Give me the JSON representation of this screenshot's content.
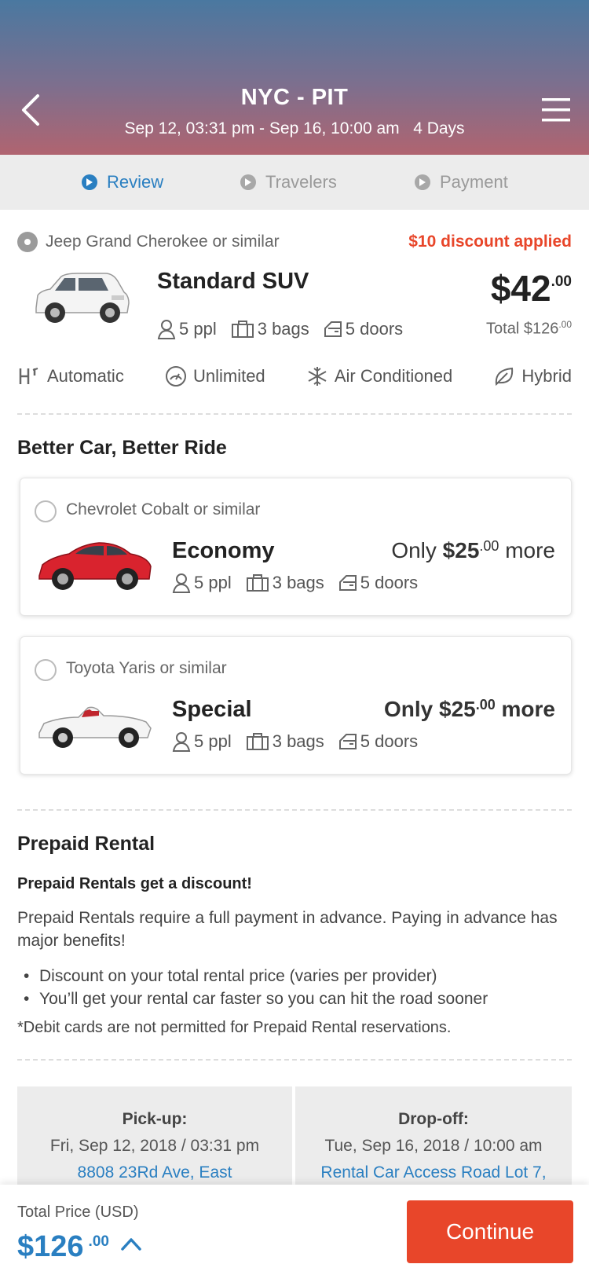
{
  "header": {
    "route": "NYC - PIT",
    "dates": "Sep 12, 03:31 pm - Sep 16, 10:00 am",
    "duration": "4 Days"
  },
  "steps": [
    {
      "label": "Review",
      "active": true
    },
    {
      "label": "Travelers",
      "active": false
    },
    {
      "label": "Payment",
      "active": false
    }
  ],
  "selected_car": {
    "similar": "Jeep Grand Cherokee or similar",
    "discount": "$10 discount applied",
    "name": "Standard SUV",
    "ppl": "5 ppl",
    "bags": "3 bags",
    "doors": "5 doors",
    "price_main": "$42",
    "price_cents": ".00",
    "total_main": "Total $126",
    "total_cents": ".00"
  },
  "features": [
    "Automatic",
    "Unlimited",
    "Air Conditioned",
    "Hybrid"
  ],
  "upgrade": {
    "title": "Better Car, Better Ride",
    "options": [
      {
        "similar": "Chevrolet Cobalt or similar",
        "name": "Economy",
        "only": "Only",
        "price": "$25",
        "cents": ".00",
        "more": "more",
        "ppl": "5 ppl",
        "bags": "3 bags",
        "doors": "5 doors",
        "color": "#d9232e"
      },
      {
        "similar": "Toyota Yaris or similar",
        "name": "Special",
        "only": "Only",
        "price": "$25",
        "cents": ".00",
        "more": "more",
        "ppl": "5 ppl",
        "bags": "3 bags",
        "doors": "5 doors",
        "color": "#f2f2f2"
      }
    ]
  },
  "prepaid": {
    "title": "Prepaid Rental",
    "subtitle": "Prepaid Rentals get a discount!",
    "text": "Prepaid Rentals require a full payment in advance. Paying in advance has major benefits!",
    "bullets": [
      "Discount on your total rental price (varies per provider)",
      "You’ll get your rental car faster so you can hit the road sooner"
    ],
    "note": "*Debit cards are not permitted for Prepaid Rental reservations."
  },
  "pickup": {
    "label": "Pick-up:",
    "date": "Fri, Sep 12, 2018 / 03:31 pm",
    "address": "8808 23Rd Ave, East"
  },
  "dropoff": {
    "label": "Drop-off:",
    "date": "Tue, Sep 16, 2018 / 10:00 am",
    "address": "Rental Car Access Road Lot 7,"
  },
  "footer": {
    "total_label": "Total Price (USD)",
    "total_main": "$126",
    "total_cents": ".00",
    "continue_label": "Continue"
  },
  "colors": {
    "accent": "#2a7fc1",
    "cta": "#e8462a"
  }
}
